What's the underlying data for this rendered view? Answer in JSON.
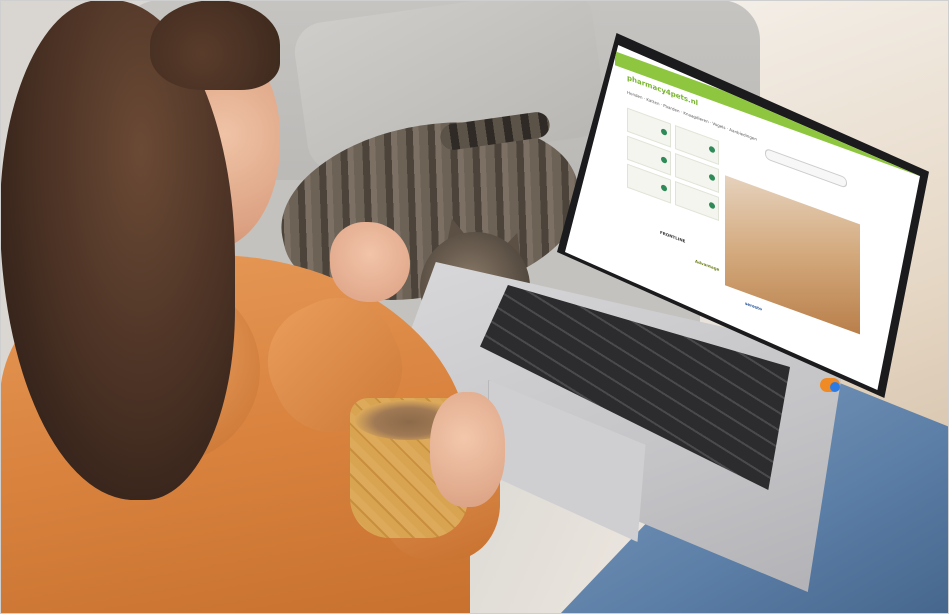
{
  "scene": {
    "description_tags": [
      "woman",
      "cat",
      "laptop",
      "mug",
      "sofa"
    ],
    "colors": {
      "hoodie": "#d9833f",
      "site_accent": "#8fc63f",
      "laptop": "#c4c4c7",
      "jeans": "#5c7fa7"
    }
  },
  "website": {
    "logo": "pharmacy4pets.nl",
    "nav": "Honden · Katten · Paarden · Knaagdieren · Vogels · Aanbiedingen",
    "hero_text": "",
    "brands": [
      "FRONTLINE",
      "Advantage",
      "seresto"
    ]
  }
}
